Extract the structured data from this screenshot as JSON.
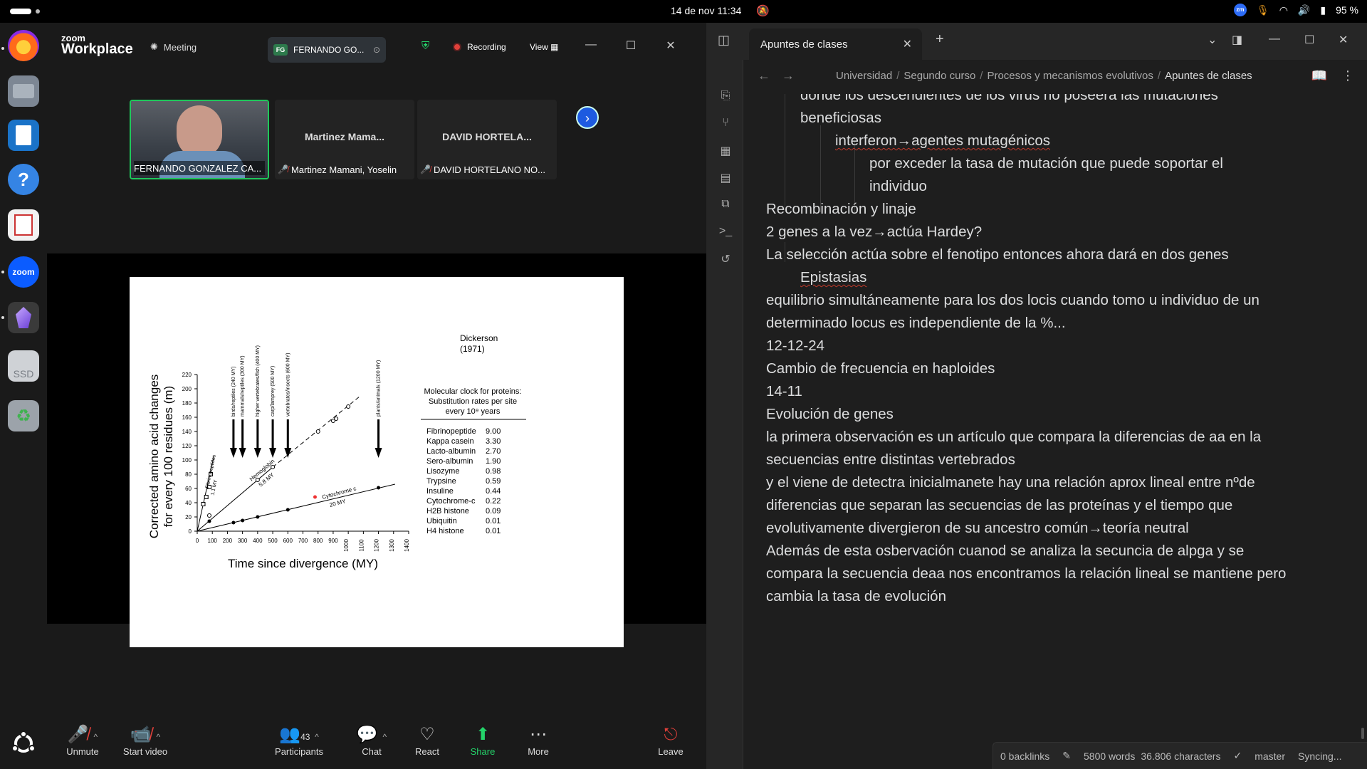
{
  "system": {
    "clock": "14 de nov  11:34",
    "battery": "95 %"
  },
  "dock": {
    "items": [
      "firefox-icon",
      "files-icon",
      "writer-icon",
      "help-icon",
      "reader-icon",
      "zoom-icon",
      "obsidian-icon",
      "ssd-drive-icon",
      "trash-icon",
      "apps-grid-icon"
    ],
    "ssd_label": "SSD",
    "zoom_label": "zoom"
  },
  "zoom": {
    "brand_top": "zoom",
    "brand": "Workplace",
    "meeting_label": "Meeting",
    "host_badge": "FG",
    "host_name": "FERNANDO GO...",
    "recording_label": "Recording",
    "view_label": "View",
    "participants": [
      {
        "display": "",
        "label": "FERNANDO GONZALEZ CA...",
        "muted": false
      },
      {
        "display": "Martinez Mama...",
        "label": "Martinez Mamani, Yoselin",
        "muted": true
      },
      {
        "display": "DAVID HORTELA...",
        "label": "DAVID HORTELANO NO...",
        "muted": true
      }
    ],
    "toolbar": {
      "unmute": "Unmute",
      "start_video": "Start video",
      "participants": "Participants",
      "participants_count": "43",
      "chat": "Chat",
      "react": "React",
      "share": "Share",
      "more": "More",
      "leave": "Leave"
    }
  },
  "slide": {
    "author": "Dickerson",
    "year": "(1971)",
    "ylabel_line1": "Corrected amino acid changes",
    "ylabel_line2": "for every 100 residues (m)",
    "xlabel": "Time since divergence (MY)",
    "table_title_1": "Molecular clock for proteins:",
    "table_title_2": "Substitution rates per site",
    "table_title_3": "every 10⁹ years",
    "arrows": [
      "birds/reptiles (240 MY)",
      "mammals/reptiles (300 MY)",
      "higher vertebrates/fish (400 MY)",
      "carp/lamprey (500 MY)",
      "vertebrates/insects (600 MY)",
      "plants/animals (1200 MY)"
    ],
    "line_labels": {
      "fibrinopeptides": "Fibrinopeptides",
      "fibrinopeptides_rate": "1.1 MY",
      "hemoglobin": "Hemoglobin",
      "hemoglobin_rate": "5.8 MY",
      "cytochrome": "Cytochrome c",
      "cytochrome_rate": "20 MY"
    }
  },
  "chart_data": {
    "type": "scatter",
    "title": "",
    "xlabel": "Time since divergence (MY)",
    "ylabel": "Corrected amino acid changes for every 100 residues (m)",
    "xlim": [
      0,
      1400
    ],
    "ylim": [
      0,
      220
    ],
    "xticks": [
      0,
      100,
      200,
      300,
      400,
      500,
      600,
      700,
      800,
      900,
      1000,
      1100,
      1200,
      1300,
      1400
    ],
    "yticks": [
      0,
      20,
      40,
      60,
      80,
      100,
      120,
      140,
      160,
      180,
      200,
      220
    ],
    "series": [
      {
        "name": "Fibrinopeptides",
        "x": [
          40,
          60,
          80,
          90
        ],
        "y": [
          38,
          48,
          62,
          80
        ]
      },
      {
        "name": "Hemoglobin",
        "x": [
          80,
          400,
          500,
          800,
          900,
          920,
          1000
        ],
        "y": [
          22,
          72,
          90,
          140,
          155,
          158,
          175
        ]
      },
      {
        "name": "Cytochrome c",
        "x": [
          80,
          240,
          300,
          400,
          600,
          1200
        ],
        "y": [
          14,
          12,
          15,
          20,
          30,
          61
        ]
      }
    ],
    "rates_table": [
      {
        "protein": "Fibrinopeptide",
        "rate": "9.00"
      },
      {
        "protein": "Kappa casein",
        "rate": "3.30"
      },
      {
        "protein": "Lacto-albumin",
        "rate": "2.70"
      },
      {
        "protein": "Sero-albumin",
        "rate": "1.90"
      },
      {
        "protein": "Lisozyme",
        "rate": "0.98"
      },
      {
        "protein": "Trypsine",
        "rate": "0.59"
      },
      {
        "protein": "Insuline",
        "rate": "0.44"
      },
      {
        "protein": "Cytochrome-c",
        "rate": "0.22"
      },
      {
        "protein": "H2B histone",
        "rate": "0.09"
      },
      {
        "protein": "Ubiquitin",
        "rate": "0.01"
      },
      {
        "protein": "H4 histone",
        "rate": "0.01"
      }
    ]
  },
  "obsidian": {
    "tab_title": "Apuntes de clases",
    "breadcrumb": [
      "Universidad",
      "Segundo curso",
      "Procesos y mecanismos evolutivos",
      "Apuntes de clases"
    ],
    "lines": [
      "donde los descendientes de los virus no poseera las mutaciones",
      "beneficiosas",
      "interferon→agentes mutagénicos",
      "por exceder la tasa de mutación que puede soportar el",
      "individuo",
      "Recombinación y linaje",
      "2 genes a la vez→actúa Hardey?",
      "La selección actúa sobre el fenotipo entonces ahora dará en dos genes",
      "Epistasias",
      "equilibrio simultáneamente para los dos locis cuando tomo u individuo de un",
      "determinado locus es independiente de la %...",
      "12-12-24",
      "Cambio de frecuencia en haploides",
      "14-11",
      "Evolución de genes",
      "la primera observación es un artículo que compara la diferencias de aa en la",
      "secuencias entre distintas vertebrados",
      "y el viene de detectra inicialmanete hay una relación aprox lineal entre nºde",
      "diferencias que separan las secuencias de las proteínas y el tiempo que",
      "evolutivamente divergieron de su ancestro común→teoría neutral",
      "Además de esta osbervación cuanod se analiza la secuncia de alpga y se",
      "compara la secuencia deaa nos encontramos la relación lineal se mantiene pero",
      "cambia la tasa de evolución"
    ],
    "status": {
      "backlinks": "0 backlinks",
      "words": "5800 words",
      "characters": "36.806 characters",
      "branch": "master",
      "sync": "Syncing..."
    }
  }
}
